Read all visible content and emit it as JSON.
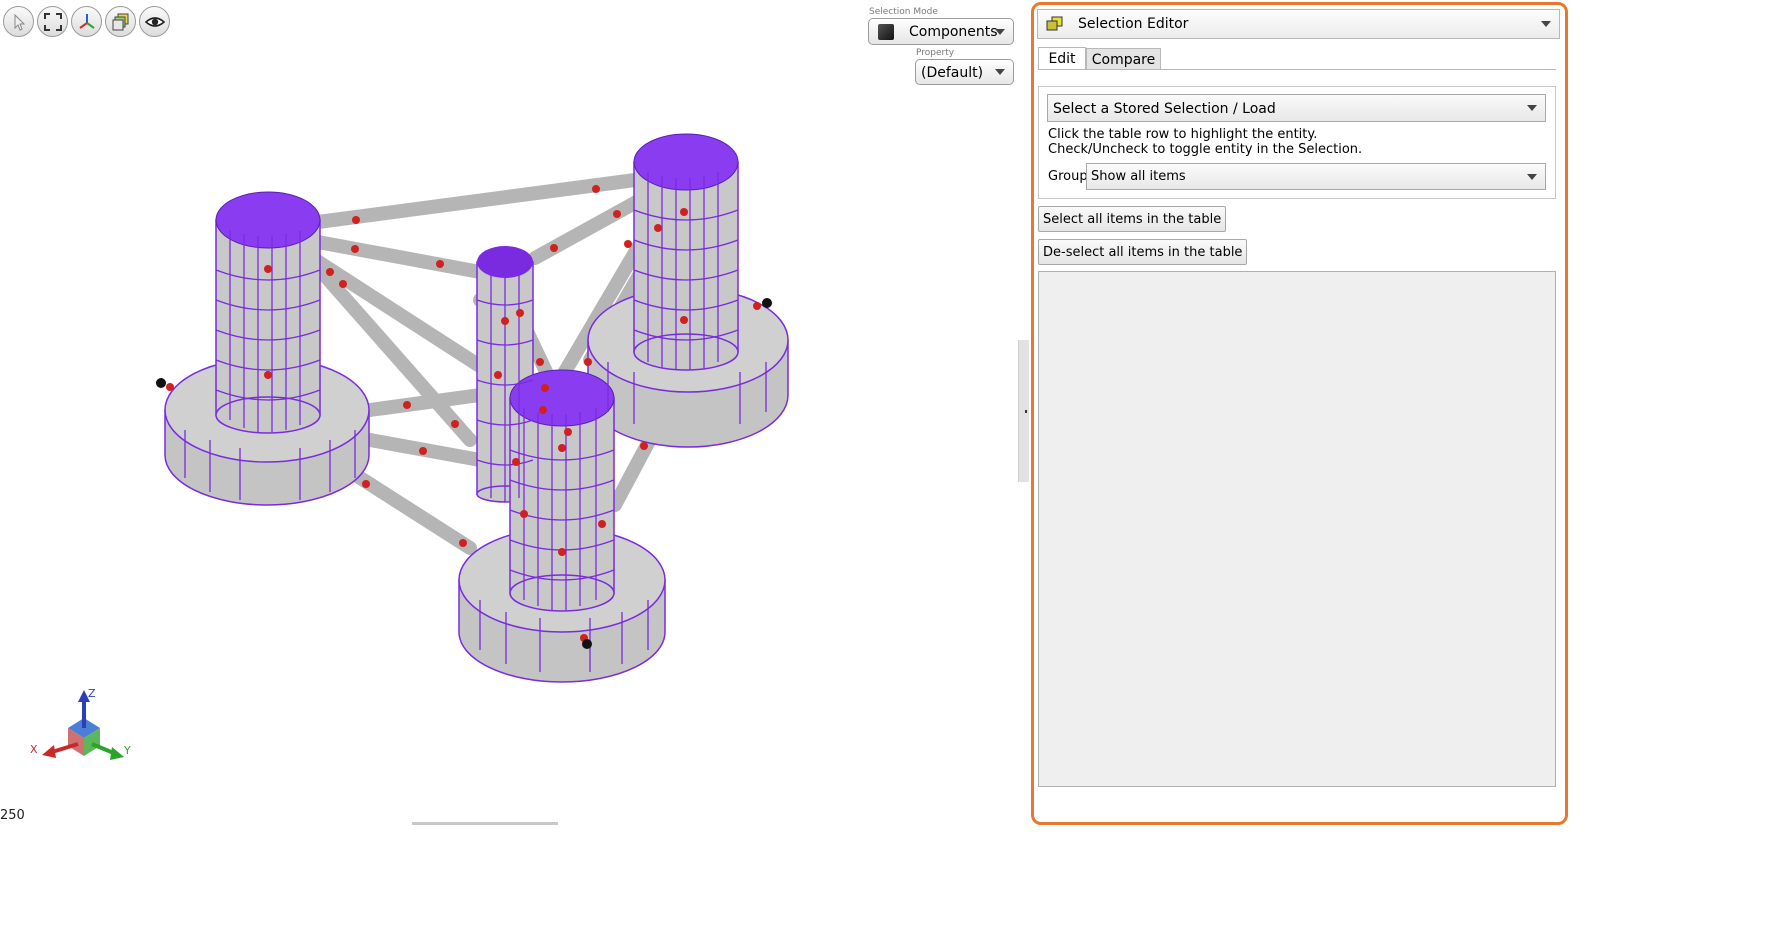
{
  "toolbar": {
    "icons": [
      "select-arrow-icon",
      "fit-view-icon",
      "axes-view-icon",
      "layers-icon",
      "visibility-eye-icon"
    ]
  },
  "selection_mode": {
    "label": "Selection Mode",
    "value": "Components",
    "property_label": "Property",
    "property_value": "(Default)"
  },
  "viewport": {
    "scale_text": "250",
    "triad": {
      "x": "X",
      "y": "Y",
      "z": "Z"
    },
    "colors": {
      "mesh": "#7a2be0",
      "surface": "#c8c8c8",
      "marker": "#d02020"
    }
  },
  "panel": {
    "title": "Selection Editor",
    "accent_color": "#e8782d",
    "tabs": [
      {
        "label": "Edit",
        "active": true
      },
      {
        "label": "Compare",
        "active": false
      }
    ],
    "stored_selection": "Select a Stored Selection / Load",
    "help_line1": "Click the table row to highlight the entity.",
    "help_line2": "Check/Uncheck to toggle entity in the Selection.",
    "group_label": "Group",
    "group_value": "Show all items",
    "select_all_label": "Select all items in the table",
    "deselect_all_label": "De-select all items in the table"
  }
}
